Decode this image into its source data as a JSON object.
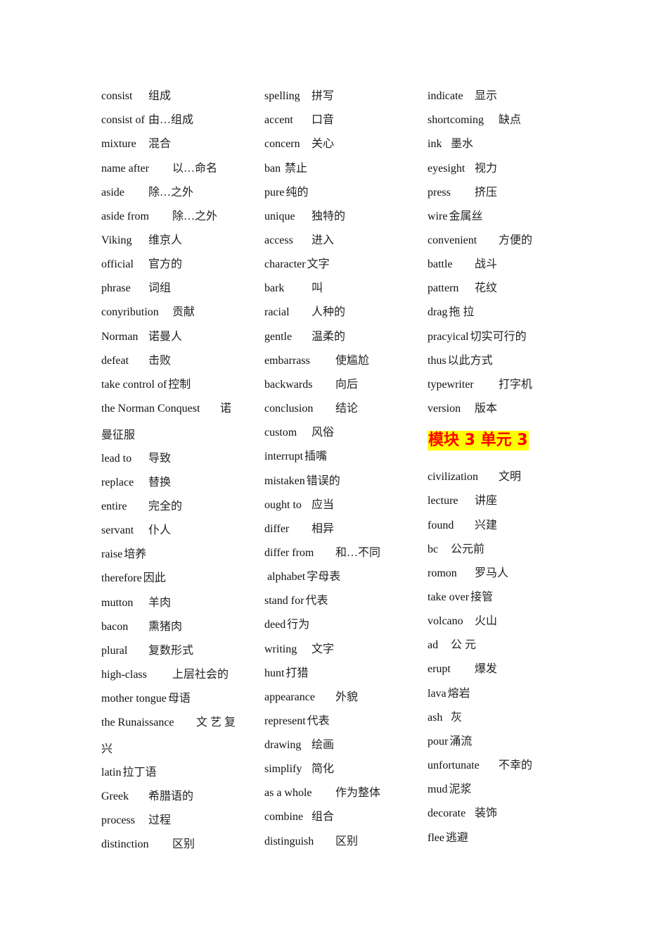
{
  "columns": [
    {
      "entries": [
        {
          "en": "consist",
          "zh": "组成"
        },
        {
          "en": "consist of",
          "zh": "由…组成"
        },
        {
          "en": "mixture",
          "zh": "混合"
        },
        {
          "en": "name after",
          "zh": "以…命名"
        },
        {
          "en": "aside",
          "zh": "除…之外"
        },
        {
          "en": "aside from",
          "zh": "除…之外"
        },
        {
          "en": "Viking",
          "zh": "维京人"
        },
        {
          "en": "official",
          "zh": "官方的"
        },
        {
          "en": "phrase",
          "zh": "词组"
        },
        {
          "en": "conyribution",
          "zh": "贡献"
        },
        {
          "en": "Norman",
          "zh": "诺曼人"
        },
        {
          "en": "defeat",
          "zh": "击败"
        },
        {
          "en": "take control of",
          "zh": "控制"
        },
        {
          "en": "the Norman Conquest",
          "zh": "诺"
        },
        {
          "en": "",
          "zh": "曼征服"
        },
        {
          "en": "lead to",
          "zh": "导致"
        },
        {
          "en": "replace",
          "zh": "替换"
        },
        {
          "en": "entire",
          "zh": "完全的"
        },
        {
          "en": "servant",
          "zh": "仆人"
        },
        {
          "en": "raise",
          "zh": "培养"
        },
        {
          "en": "therefore",
          "zh": "因此"
        },
        {
          "en": "mutton",
          "zh": "羊肉"
        },
        {
          "en": "bacon",
          "zh": "熏猪肉"
        },
        {
          "en": "plural",
          "zh": "复数形式"
        },
        {
          "en": "high-class",
          "zh": "上层社会的"
        },
        {
          "en": "mother tongue",
          "zh": "母语"
        },
        {
          "en": "the Runaissance",
          "zh": "文 艺 复"
        },
        {
          "en": "",
          "zh": "兴"
        },
        {
          "en": "latin",
          "zh": "拉丁语"
        },
        {
          "en": "Greek",
          "zh": "希腊语的"
        },
        {
          "en": "process",
          "zh": "过程"
        },
        {
          "en": "distinction",
          "zh": "区别"
        }
      ]
    },
    {
      "entries": [
        {
          "en": "spelling",
          "zh": "拼写"
        },
        {
          "en": "accent",
          "zh": "口音"
        },
        {
          "en": "concern",
          "zh": "关心"
        },
        {
          "en": "ban",
          "zh": "禁止"
        },
        {
          "en": "pure",
          "zh": "纯的"
        },
        {
          "en": "unique",
          "zh": "独特的"
        },
        {
          "en": "access",
          "zh": "进入"
        },
        {
          "en": "character",
          "zh": "文字"
        },
        {
          "en": "bark",
          "zh": "叫"
        },
        {
          "en": "racial",
          "zh": "人种的"
        },
        {
          "en": "gentle",
          "zh": "温柔的"
        },
        {
          "en": "embarrass",
          "zh": "使尴尬"
        },
        {
          "en": "backwards",
          "zh": "向后"
        },
        {
          "en": "conclusion",
          "zh": "结论"
        },
        {
          "en": "custom",
          "zh": "风俗"
        },
        {
          "en": "interrupt",
          "zh": "插嘴"
        },
        {
          "en": "mistaken",
          "zh": "错误的"
        },
        {
          "en": "ought to",
          "zh": "应当"
        },
        {
          "en": "differ",
          "zh": "相异"
        },
        {
          "en": "differ from",
          "zh": "和…不同"
        },
        {
          "en": " alphabet",
          "zh": "字母表"
        },
        {
          "en": "stand for",
          "zh": "代表"
        },
        {
          "en": "deed",
          "zh": "行为"
        },
        {
          "en": "writing",
          "zh": "文字"
        },
        {
          "en": "hunt",
          "zh": "打猎"
        },
        {
          "en": "appearance",
          "zh": "外貌"
        },
        {
          "en": "represent",
          "zh": "代表"
        },
        {
          "en": "drawing",
          "zh": "绘画"
        },
        {
          "en": "simplify",
          "zh": "简化"
        },
        {
          "en": "as a whole",
          "zh": "作为整体"
        },
        {
          "en": "combine",
          "zh": "组合"
        },
        {
          "en": "distinguish",
          "zh": "区别"
        }
      ]
    },
    {
      "entries": [
        {
          "en": "indicate",
          "zh": "显示"
        },
        {
          "en": "shortcoming",
          "zh": "缺点"
        },
        {
          "en": "ink",
          "zh": "墨水"
        },
        {
          "en": "eyesight",
          "zh": "视力"
        },
        {
          "en": "press",
          "zh": "挤压"
        },
        {
          "en": "wire",
          "zh": "金属丝"
        },
        {
          "en": "convenient",
          "zh": "方便的"
        },
        {
          "en": "battle",
          "zh": "战斗"
        },
        {
          "en": "pattern",
          "zh": "花纹"
        },
        {
          "en": "drag",
          "zh": "拖 拉"
        },
        {
          "en": "pracyical",
          "zh": "切实可行的"
        },
        {
          "en": "thus",
          "zh": "以此方式"
        },
        {
          "en": "typewriter",
          "zh": "打字机"
        },
        {
          "en": "version",
          "zh": "版本"
        }
      ],
      "heading": "模块 3 单元 3",
      "entries_after": [
        {
          "en": "civilization",
          "zh": "文明"
        },
        {
          "en": "lecture",
          "zh": "讲座"
        },
        {
          "en": "found",
          "zh": "兴建"
        },
        {
          "en": "bc",
          "zh": "公元前"
        },
        {
          "en": "romon",
          "zh": "罗马人"
        },
        {
          "en": "take over",
          "zh": "接管"
        },
        {
          "en": "volcano",
          "zh": "火山"
        },
        {
          "en": "ad",
          "zh": "公 元"
        },
        {
          "en": "erupt",
          "zh": "爆发"
        },
        {
          "en": "lava",
          "zh": "熔岩"
        },
        {
          "en": "ash",
          "zh": "灰"
        },
        {
          "en": "pour",
          "zh": "涌流"
        },
        {
          "en": "unfortunate",
          "zh": "不幸的"
        },
        {
          "en": "mud",
          "zh": "泥浆"
        },
        {
          "en": "decorate",
          "zh": "装饰"
        },
        {
          "en": "flee",
          "zh": "逃避"
        }
      ]
    }
  ],
  "colors": {
    "heading_text": "#ff0000",
    "heading_highlight": "#ffff00"
  }
}
